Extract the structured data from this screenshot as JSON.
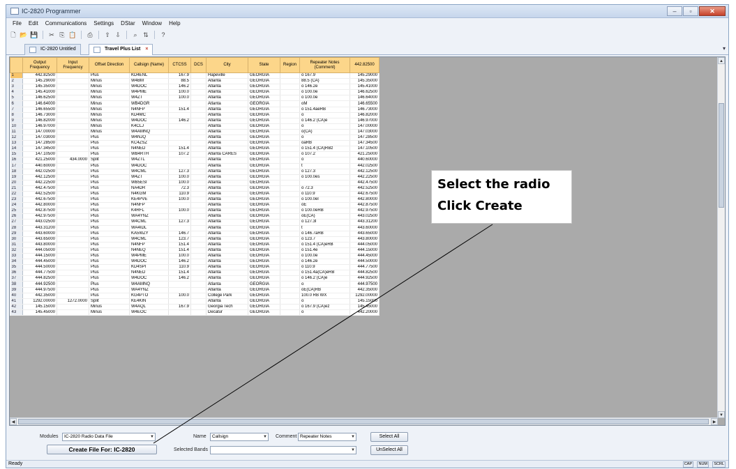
{
  "window": {
    "title": "IC-2820 Programmer",
    "controls": [
      "‒",
      "▫",
      "✕"
    ]
  },
  "menu": [
    "File",
    "Edit",
    "Communications",
    "Settings",
    "DStar",
    "Window",
    "Help"
  ],
  "tabs": [
    {
      "label": "IC-2820 Untitled",
      "icon": "radio-icon"
    },
    {
      "label": "Travel Plus List",
      "icon": "list-icon"
    }
  ],
  "tab_close": "×",
  "grid": {
    "columns": [
      "",
      "Output Frequency",
      "Input Frequency",
      "Offset Direction",
      "Callsign (Name)",
      "CTCSS",
      "DCS",
      "City",
      "State",
      "Region",
      "Repeater Notes (Comment)",
      "442.82500"
    ],
    "rows": [
      [
        "1",
        "442.82500",
        "",
        "Plus",
        "KD4ENL",
        "167.9",
        "",
        "Hapeville",
        "GEORGIA",
        "",
        "o 167.9",
        "145.29000"
      ],
      [
        "2",
        "145.29000",
        "",
        "Minus",
        "W4BM",
        "88.5",
        "",
        "Atlanta",
        "GEORGIA",
        "",
        "88.5 (CA)",
        "145.35000"
      ],
      [
        "3",
        "145.35000",
        "",
        "Minus",
        "W4DOC",
        "146.2",
        "",
        "Atlanta",
        "GEORGIA",
        "",
        "o 146.2e",
        "145.41000"
      ],
      [
        "4",
        "145.41000",
        "",
        "Minus",
        "W4PME",
        "100.0",
        "",
        "Atlanta",
        "GEORGIA",
        "",
        "o 100.0e",
        "146.62500"
      ],
      [
        "5",
        "146.62500",
        "",
        "Minus",
        "W4ZT",
        "100.0",
        "",
        "Atlanta",
        "GEORGIA",
        "",
        "o 100.0e",
        "146.64000"
      ],
      [
        "6",
        "146.64000",
        "",
        "Minus",
        "WB4DGR",
        "",
        "",
        "Atlanta",
        "GEORGIA",
        "",
        "oM",
        "146.65500"
      ],
      [
        "7",
        "146.65500",
        "",
        "Minus",
        "N4NFP",
        "151.4",
        "",
        "Atlanta",
        "GEORGIA",
        "",
        "o 151.4aeRB",
        "146.73000"
      ],
      [
        "8",
        "146.73000",
        "",
        "Minus",
        "KD4MC",
        "",
        "",
        "Atlanta",
        "GEORGIA",
        "",
        "o",
        "146.82000"
      ],
      [
        "9",
        "146.82000",
        "",
        "Minus",
        "W4DOC",
        "146.2",
        "",
        "Atlanta",
        "GEORGIA",
        "",
        "o 146.2 (CA)e",
        "146.97000"
      ],
      [
        "10",
        "146.97000",
        "",
        "Minus",
        "K4CLJ",
        "",
        "",
        "Atlanta",
        "GEORGIA",
        "",
        "o",
        "147.00000"
      ],
      [
        "11",
        "147.00000",
        "",
        "Minus",
        "W4AMNQ",
        "",
        "",
        "Atlanta",
        "GEORGIA",
        "",
        "o(CA)",
        "147.03000"
      ],
      [
        "12",
        "147.03000",
        "",
        "Plus",
        "W4NJQ",
        "",
        "",
        "Atlanta",
        "GEORGIA",
        "",
        "o",
        "147.28500"
      ],
      [
        "13",
        "147.28500",
        "",
        "Plus",
        "KC4ZSZ",
        "",
        "",
        "Atlanta",
        "GEORGIA",
        "",
        "oaRB",
        "147.34500"
      ],
      [
        "14",
        "147.34500",
        "",
        "Plus",
        "N4NED",
        "151.4",
        "",
        "Atlanta",
        "GEORGIA",
        "",
        "o 151.4 (CA)RBz",
        "147.10500"
      ],
      [
        "15",
        "147.10500",
        "",
        "Plus",
        "WB4RTH",
        "107.2",
        "",
        "Atlanta CARES",
        "GEORGIA",
        "",
        "o 107.2",
        "421.25000"
      ],
      [
        "16",
        "421.25000",
        "434.0000",
        "Split",
        "W4ZTL",
        "",
        "",
        "Atlanta",
        "GEORGIA",
        "",
        "o",
        "440.60000"
      ],
      [
        "17",
        "440.60000",
        "",
        "Plus",
        "W4DOC",
        "",
        "",
        "Atlanta",
        "GEORGIA",
        "",
        "t",
        "442.02500"
      ],
      [
        "18",
        "442.02500",
        "",
        "Plus",
        "W4CML",
        "127.3",
        "",
        "Atlanta",
        "GEORGIA",
        "",
        "o 127.3",
        "442.12500"
      ],
      [
        "19",
        "442.12500",
        "",
        "Plus",
        "W4ZT",
        "100.0",
        "",
        "Atlanta",
        "GEORGIA",
        "",
        "o 100.0es",
        "442.22500"
      ],
      [
        "20",
        "442.22500",
        "",
        "Plus",
        "WB5ESI",
        "100.0",
        "",
        "Atlanta",
        "GEORGIA",
        "",
        "",
        "442.47500"
      ],
      [
        "21",
        "442.47500",
        "",
        "Plus",
        "NA4DR",
        "72.3",
        "",
        "Atlanta",
        "GEORGIA",
        "",
        "o 72.3",
        "442.52500"
      ],
      [
        "22",
        "442.52500",
        "",
        "Plus",
        "N4KGM",
        "110.9",
        "",
        "Atlanta",
        "GEORGIA",
        "",
        "o 110.9",
        "442.67500"
      ],
      [
        "23",
        "442.67500",
        "",
        "Plus",
        "KE4PVE",
        "100.0",
        "",
        "Atlanta",
        "GEORGIA",
        "",
        "o 100.0el",
        "442.80000"
      ],
      [
        "24",
        "442.80000",
        "",
        "Plus",
        "N4NFP",
        "",
        "",
        "Atlanta",
        "GEORGIA",
        "",
        "oE",
        "442.87500"
      ],
      [
        "25",
        "442.87500",
        "",
        "Plus",
        "K4RFL",
        "100.0",
        "",
        "Atlanta",
        "GEORGIA",
        "",
        "o 100.0eRB",
        "442.97500"
      ],
      [
        "26",
        "442.97500",
        "",
        "Plus",
        "WA4YNZ",
        "",
        "",
        "Atlanta",
        "GEORGIA",
        "",
        "oE(CA)",
        "443.02500"
      ],
      [
        "27",
        "443.02500",
        "",
        "Plus",
        "W4CML",
        "127.3",
        "",
        "Atlanta",
        "GEORGIA",
        "",
        "o 127.3l",
        "443.31200"
      ],
      [
        "28",
        "443.31200",
        "",
        "Plus",
        "WA4IDL",
        "",
        "",
        "Atlanta",
        "GEORGIA",
        "",
        "t",
        "443.60000"
      ],
      [
        "29",
        "443.60000",
        "",
        "Plus",
        "KA5WZY",
        "146.7",
        "",
        "Atlanta",
        "GEORGIA",
        "",
        "o 146.7aRB",
        "443.65000"
      ],
      [
        "30",
        "443.65000",
        "",
        "Plus",
        "W4CML",
        "123.7",
        "",
        "Atlanta",
        "GEORGIA",
        "",
        "o 123.7",
        "443.80000"
      ],
      [
        "31",
        "443.80000",
        "",
        "Plus",
        "N4NFP",
        "151.4",
        "",
        "Atlanta",
        "GEORGIA",
        "",
        "o 151.4 (CA)eRB",
        "444.05000"
      ],
      [
        "32",
        "444.05000",
        "",
        "Plus",
        "N4NEQ",
        "151.4",
        "",
        "Atlanta",
        "GEORGIA",
        "",
        "o 151.4e",
        "444.15000"
      ],
      [
        "33",
        "444.15000",
        "",
        "Plus",
        "W4PME",
        "100.0",
        "",
        "Atlanta",
        "GEORGIA",
        "",
        "o 100.0e",
        "444.45000"
      ],
      [
        "34",
        "444.45000",
        "",
        "Plus",
        "W4DOC",
        "146.2",
        "",
        "Atlanta",
        "GEORGIA",
        "",
        "o 146.2e",
        "444.50000"
      ],
      [
        "35",
        "444.50000",
        "",
        "Plus",
        "KD4SPI",
        "110.9",
        "",
        "Atlanta",
        "GEORGIA",
        "",
        "o 110.9",
        "444.77500"
      ],
      [
        "36",
        "444.77500",
        "",
        "Plus",
        "N4NED",
        "151.4",
        "",
        "Atlanta",
        "GEORGIA",
        "",
        "o 151.4a(CA)eRB",
        "444.82500"
      ],
      [
        "37",
        "444.82500",
        "",
        "Plus",
        "W4DOC",
        "146.2",
        "",
        "Atlanta",
        "GEORGIA",
        "",
        "o 146.2 (CA)e",
        "444.92500"
      ],
      [
        "38",
        "444.92500",
        "",
        "Plus",
        "W4AMNQ",
        "",
        "",
        "Atlanta",
        "GEORGIA",
        "",
        "o",
        "444.97500"
      ],
      [
        "39",
        "444.97500",
        "",
        "Plus",
        "WA4YNZ",
        "",
        "",
        "Atlanta",
        "GEORGIA",
        "",
        "oE(CA)RB",
        "442.35000"
      ],
      [
        "40",
        "442.35000",
        "",
        "Plus",
        "KG4PTO",
        "100.0",
        "",
        "College Park",
        "GEORGIA",
        "",
        "100.0 RB WX",
        "1292.00000"
      ],
      [
        "41",
        "1292.00000",
        "1272.0000",
        "Split",
        "KE4KIN",
        "",
        "",
        "Atlanta",
        "GEORGIA",
        "",
        "o",
        "145.15000"
      ],
      [
        "42",
        "145.15000",
        "",
        "Minus",
        "W4AQL",
        "167.9",
        "",
        "Georgia Tech",
        "GEORGIA",
        "",
        "o 167.9 (CA)ez",
        "145.45000"
      ],
      [
        "43",
        "145.45000",
        "",
        "Minus",
        "W4EOC",
        "",
        "",
        "Decatur",
        "GEORGIA",
        "",
        "o",
        "442.20000"
      ]
    ]
  },
  "bottom": {
    "modules_label": "Modules",
    "modules_value": "IC-2820 Radio Data File",
    "name_label": "Name",
    "name_value": "Callsign",
    "comment_label": "Comment",
    "comment_value": "Repeater Notes",
    "select_all": "Select All",
    "unselect_all": "UnSelect All",
    "create_button": "Create File For: IC-2820",
    "selected_bands_label": "Selected Bands",
    "selected_bands_value": ""
  },
  "status": {
    "text": "Ready",
    "indicators": [
      "CAP",
      "NUM",
      "SCRL"
    ]
  },
  "callout": {
    "line1": "Select the radio",
    "line2": "Click Create"
  },
  "colors": {
    "header": "#fcd68a",
    "selected_row": "#f7c46a",
    "grid_empty": "#aaaaaa",
    "titlebar": "#c6d6ec"
  }
}
